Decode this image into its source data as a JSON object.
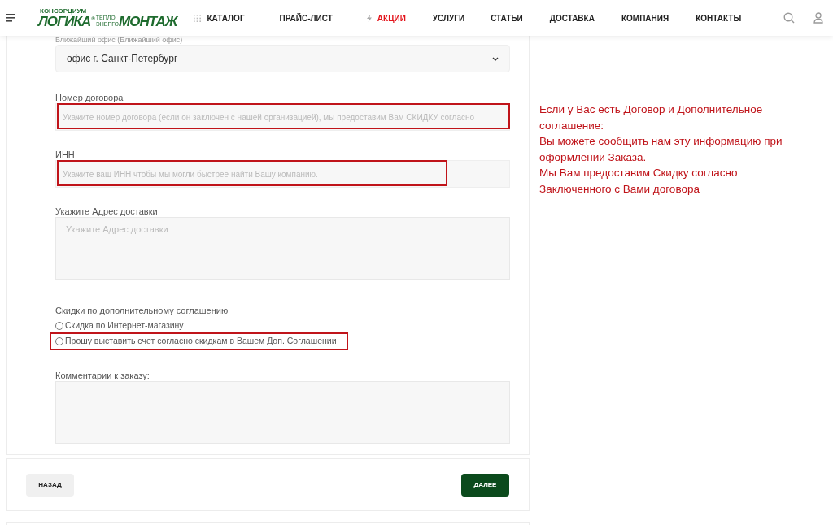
{
  "header": {
    "logo": {
      "top": "КОНСОРЦИУМ",
      "word1": "ЛОГИКА",
      "mark": "®",
      "small_top": "ТЕПЛО",
      "small_bottom": "ЭНЕРГО",
      "word2": "МОНТАЖ"
    },
    "nav": [
      {
        "label": "КАТАЛОГ",
        "kind": "grid"
      },
      {
        "label": "ПРАЙС-ЛИСТ",
        "kind": "plain"
      },
      {
        "label": "АКЦИИ",
        "kind": "promo"
      },
      {
        "label": "УСЛУГИ",
        "kind": "plain"
      },
      {
        "label": "СТАТЬИ",
        "kind": "plain"
      },
      {
        "label": "ДОСТАВКА",
        "kind": "plain"
      },
      {
        "label": "КОМПАНИЯ",
        "kind": "plain"
      },
      {
        "label": "КОНТАКТЫ",
        "kind": "plain"
      }
    ]
  },
  "form": {
    "office": {
      "label": "Ближайший офис (Ближайший офис)",
      "value": "офис г. Санкт-Петербург"
    },
    "fields": [
      {
        "label": "Номер договора",
        "placeholder": "Укажите номер договора (если он заключен с нашей организацией), мы предоставим Вам СКИДКУ согласно",
        "kind": "input",
        "highlighted": true
      },
      {
        "label": "ИНН",
        "placeholder": "Укажите ваш ИНН чтобы мы могли быстрее найти Вашу компанию.",
        "kind": "input",
        "highlighted": true
      },
      {
        "label": "Укажите Адрес доставки",
        "placeholder": "Укажите Адрес доставки",
        "kind": "textarea",
        "highlighted": false
      }
    ],
    "discount": {
      "label": "Скидки по дополнительному соглашению",
      "options": [
        {
          "label": "Скидка по Интернет-магазину",
          "selected": false,
          "highlighted": false
        },
        {
          "label": "Прошу выставить счет согласно скидкам в Вашем Доп. Соглашении",
          "selected": false,
          "highlighted": true
        }
      ]
    },
    "comment": {
      "label": "Комментарии к заказу:"
    },
    "buttons": {
      "back": "НАЗАД",
      "next": "ДАЛЕЕ"
    }
  },
  "note": [
    "Если у Вас есть Договор и Дополнительное соглашение:",
    "Вы можете сообщить нам эту информацию при оформлении Заказа.",
    "Мы Вам предоставим Скидку согласно Заключенного с Вами договора"
  ]
}
